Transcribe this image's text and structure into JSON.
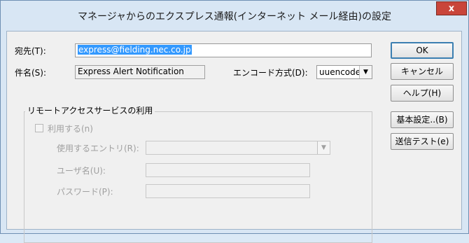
{
  "window": {
    "title": "マネージャからのエクスプレス通報(インターネット メール経由)の設定",
    "close_label": "x"
  },
  "form": {
    "recipient_label": "宛先(T):",
    "recipient_value": "express@fielding.nec.co.jp",
    "subject_label": "件名(S):",
    "subject_value": "Express Alert Notification",
    "encode_label": "エンコード方式(D):",
    "encode_value": "uuencode"
  },
  "buttons": {
    "ok": "OK",
    "cancel": "キャンセル",
    "help": "ヘルプ(H)",
    "basic_settings": "基本設定..(B)",
    "send_test": "送信テスト(e)"
  },
  "remote_access": {
    "group_title": "リモートアクセスサービスの利用",
    "use_label": "利用する(n)",
    "use_checked": false,
    "entry_label": "使用するエントリ(R):",
    "entry_value": "",
    "username_label": "ユーザ名(U):",
    "username_value": "",
    "password_label": "パスワード(P):",
    "password_value": ""
  },
  "colors": {
    "title_bg": "#d8e6f4",
    "close_bg": "#c9453a",
    "selection": "#3399ff"
  }
}
